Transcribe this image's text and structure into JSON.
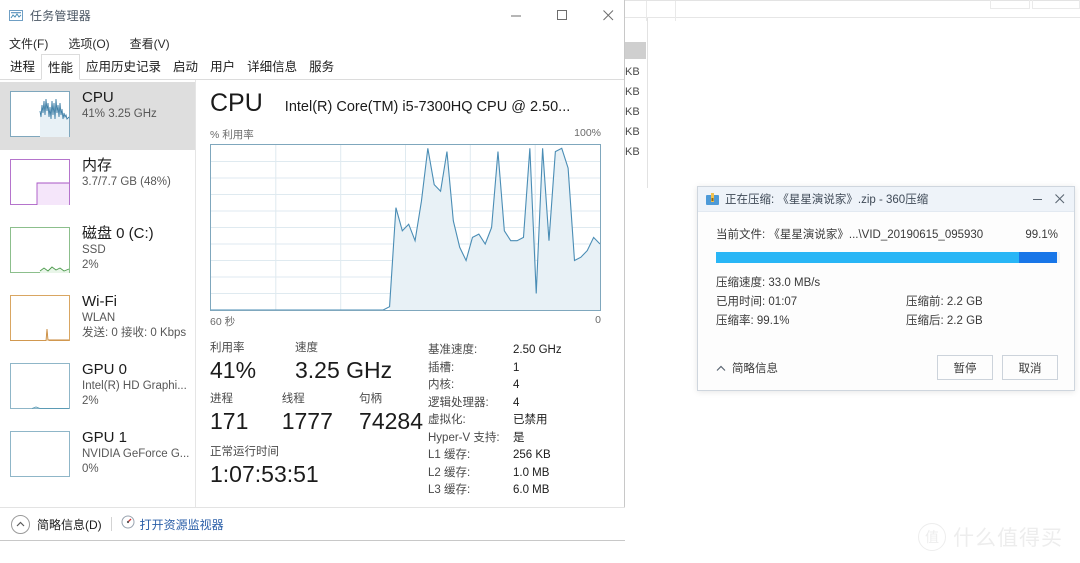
{
  "taskmanager": {
    "title": "任务管理器",
    "window_controls": {
      "minimize": "minimize-icon",
      "maximize": "maximize-icon",
      "close": "close-icon"
    },
    "menu": [
      "文件(F)",
      "选项(O)",
      "查看(V)"
    ],
    "tabs": [
      {
        "label": "进程",
        "active": false
      },
      {
        "label": "性能",
        "active": true
      },
      {
        "label": "应用历史记录",
        "active": false
      },
      {
        "label": "启动",
        "active": false
      },
      {
        "label": "用户",
        "active": false
      },
      {
        "label": "详细信息",
        "active": false
      },
      {
        "label": "服务",
        "active": false
      }
    ],
    "resources": [
      {
        "name": "CPU",
        "sub1": "41%  3.25 GHz",
        "sub2": "",
        "color": "#3d7ea6",
        "selected": true
      },
      {
        "name": "内存",
        "sub1": "3.7/7.7 GB (48%)",
        "sub2": "",
        "color": "#a855c4",
        "selected": false
      },
      {
        "name": "磁盘 0 (C:)",
        "sub1": "SSD",
        "sub2": "2%",
        "color": "#4c9a4c",
        "selected": false
      },
      {
        "name": "Wi-Fi",
        "sub1": "WLAN",
        "sub2": "发送: 0 接收: 0 Kbps",
        "color": "#c98a3c",
        "selected": false
      },
      {
        "name": "GPU 0",
        "sub1": "Intel(R) HD Graphi...",
        "sub2": "2%",
        "color": "#5b9bb5",
        "selected": false
      },
      {
        "name": "GPU 1",
        "sub1": "NVIDIA GeForce G...",
        "sub2": "0%",
        "color": "#5b9bb5",
        "selected": false
      }
    ],
    "detail": {
      "heading": "CPU",
      "model": "Intel(R) Core(TM) i5-7300HQ CPU @ 2.50...",
      "chart_top_label": "% 利用率",
      "chart_top_right": "100%",
      "chart_bottom_left": "60 秒",
      "chart_bottom_right": "0",
      "stats": [
        {
          "label": "利用率",
          "value": "41%"
        },
        {
          "label": "速度",
          "value": "3.25 GHz"
        },
        {
          "label": "进程",
          "value": "171"
        },
        {
          "label": "线程",
          "value": "1777"
        },
        {
          "label": "句柄",
          "value": "74284"
        }
      ],
      "uptime_label": "正常运行时间",
      "uptime_value": "1:07:53:51",
      "specs": [
        {
          "key": "基准速度:",
          "value": "2.50 GHz"
        },
        {
          "key": "插槽:",
          "value": "1"
        },
        {
          "key": "内核:",
          "value": "4"
        },
        {
          "key": "逻辑处理器:",
          "value": "4"
        },
        {
          "key": "虚拟化:",
          "value": "已禁用"
        },
        {
          "key": "Hyper-V 支持:",
          "value": "是"
        },
        {
          "key": "L1 缓存:",
          "value": "256 KB"
        },
        {
          "key": "L2 缓存:",
          "value": "1.0 MB"
        },
        {
          "key": "L3 缓存:",
          "value": "6.0 MB"
        }
      ]
    },
    "statusbar": {
      "fewer_details": "简略信息(D)",
      "resource_monitor": "打开资源监视器"
    }
  },
  "compress_dialog": {
    "title": "正在压缩: 《星星演说家》.zip - 360压缩",
    "window_controls": {
      "minimize": "minimize-icon",
      "close": "close-icon"
    },
    "current_file_label": "当前文件:",
    "current_file_value": "《星星演说家》...\\VID_20190615_095930",
    "percent": "99.1%",
    "progress_value": 99.1,
    "progress_light_pct": 88,
    "rows": [
      {
        "left_label": "压缩速度:",
        "left_value": "33.0 MB/s",
        "right_label": "",
        "right_value": ""
      },
      {
        "left_label": "已用时间:",
        "left_value": "01:07",
        "right_label": "压缩前:",
        "right_value": "2.2 GB"
      },
      {
        "left_label": "压缩率:",
        "left_value": "99.1%",
        "right_label": "压缩后:",
        "right_value": "2.2 GB"
      }
    ],
    "brief_info": "简略信息",
    "buttons": {
      "pause": "暂停",
      "cancel": "取消"
    },
    "colors": {
      "progress_light": "#29b6f6",
      "progress_dark": "#1876e8",
      "titlebar": "#eef3f9"
    }
  },
  "background_window": {
    "kb_cells": [
      "KB",
      "KB",
      "KB",
      "KB",
      "KB"
    ]
  },
  "watermark": {
    "badge": "值",
    "text": "什么值得买"
  },
  "chart_data": {
    "type": "area",
    "title": "% 利用率",
    "xlabel": "60 秒",
    "ylabel": "% 利用率",
    "ylim": [
      0,
      100
    ],
    "xlim": [
      0,
      60
    ],
    "grid": true,
    "x_axis_right_label": "0",
    "y_axis_top_label": "100%",
    "line_color": "#4a8db5",
    "fill_color": "#e8f1f6",
    "values": [
      0,
      0,
      0,
      0,
      0,
      0,
      0,
      0,
      0,
      0,
      0,
      0,
      0,
      0,
      0,
      0,
      0,
      0,
      0,
      0,
      0,
      0,
      0,
      0,
      0,
      0,
      0,
      0,
      2,
      62,
      48,
      52,
      42,
      66,
      98,
      76,
      72,
      96,
      54,
      38,
      30,
      44,
      46,
      40,
      50,
      96,
      48,
      42,
      42,
      44,
      98,
      10,
      98,
      42,
      96,
      98,
      86,
      30,
      32,
      36,
      44,
      40
    ]
  }
}
